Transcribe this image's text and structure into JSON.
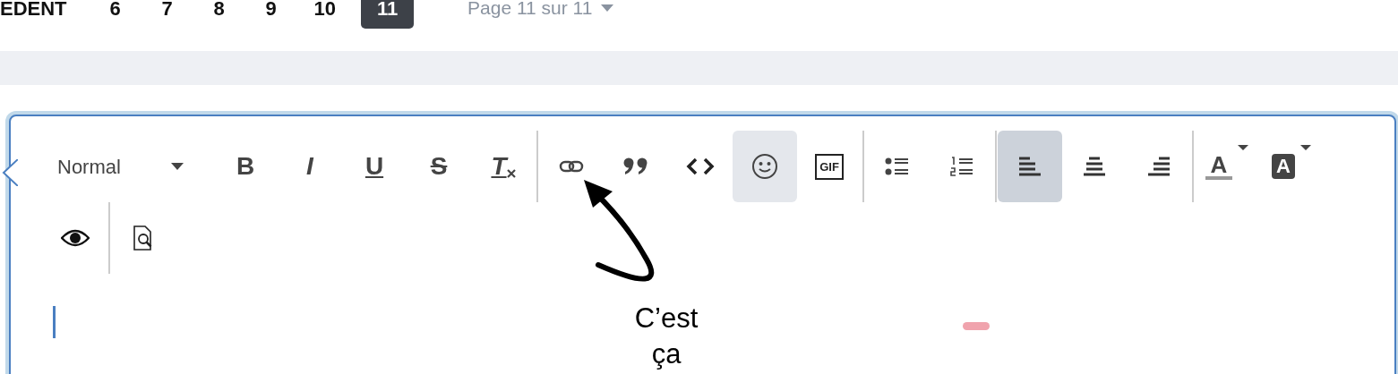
{
  "pagination": {
    "previous_label": "EDENT",
    "pages": [
      {
        "label": "6",
        "selected": false
      },
      {
        "label": "7",
        "selected": false
      },
      {
        "label": "8",
        "selected": false
      },
      {
        "label": "9",
        "selected": false
      },
      {
        "label": "10",
        "selected": false
      },
      {
        "label": "11",
        "selected": true
      }
    ],
    "page_menu": "Page 11 sur 11"
  },
  "editor": {
    "style_select": "Normal",
    "toolbar_rows": [
      [
        {
          "kind": "bold",
          "label": "B",
          "selected": false
        },
        {
          "kind": "italic",
          "label": "I",
          "selected": false
        },
        {
          "kind": "underline",
          "label": "U",
          "selected": false
        },
        {
          "kind": "strike",
          "label": "S",
          "selected": false
        },
        {
          "kind": "clear",
          "label": "T",
          "selected": false
        },
        {
          "kind": "separator"
        },
        {
          "kind": "link",
          "selected": false
        },
        {
          "kind": "quote",
          "selected": false
        },
        {
          "kind": "code",
          "selected": false
        },
        {
          "kind": "emoji",
          "selected": true
        },
        {
          "kind": "gif",
          "label": "GIF",
          "selected": false
        },
        {
          "kind": "separator"
        },
        {
          "kind": "bullets",
          "selected": false
        },
        {
          "kind": "numbers",
          "selected": false
        },
        {
          "kind": "separator"
        },
        {
          "kind": "align-left",
          "selected": true
        },
        {
          "kind": "align-center",
          "selected": false
        },
        {
          "kind": "align-right",
          "selected": false
        },
        {
          "kind": "separator"
        },
        {
          "kind": "text-color",
          "label": "A",
          "selected": false
        },
        {
          "kind": "highlight",
          "label": "A",
          "selected": false
        }
      ],
      [
        {
          "kind": "preview",
          "selected": false
        },
        {
          "kind": "separator"
        },
        {
          "kind": "preview-page",
          "selected": false
        }
      ]
    ]
  },
  "annotation": {
    "text": "C’est ça"
  }
}
